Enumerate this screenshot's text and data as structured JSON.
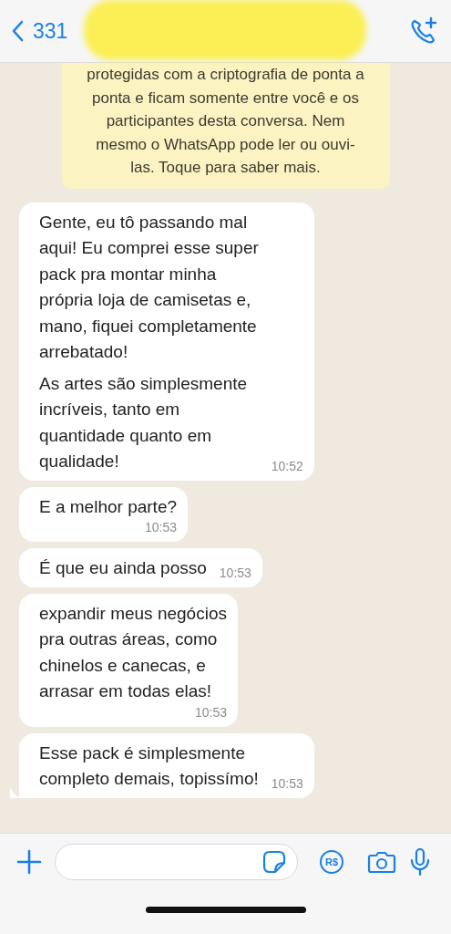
{
  "header": {
    "back_label": "331"
  },
  "encryption_notice": {
    "text": "protegidas com a criptografia de ponta a\nponta e ficam somente entre você e os\nparticipantes desta conversa. Nem\nmesmo o WhatsApp pode ler ou ouvi-\nlas. Toque para saber mais."
  },
  "messages": [
    {
      "kind": "inline",
      "paragraphs": [
        "Gente, eu tô passando mal\naqui! Eu comprei esse super\npack pra montar minha\nprópria loja de camisetas e,\nmano, fiquei completamente\narrebatado!",
        "As artes são simplesmente\nincríveis, tanto em\nquantidade quanto em\nqualidade!"
      ],
      "time": "10:52",
      "tail": false
    },
    {
      "kind": "stacked",
      "paragraphs": [
        "E a melhor parte?"
      ],
      "time": "10:53",
      "tail": false
    },
    {
      "kind": "inline",
      "paragraphs": [
        "É que eu ainda posso"
      ],
      "time": "10:53",
      "tail": false
    },
    {
      "kind": "stacked",
      "paragraphs": [
        "expandir meus negócios\npra outras áreas, como\nchinelos e canecas, e\narrasar em todas elas!"
      ],
      "time": "10:53",
      "tail": false
    },
    {
      "kind": "inline",
      "paragraphs": [
        "Esse pack é simplesmente\ncompleto demais, topissímo!"
      ],
      "time": "10:53",
      "tail": true
    }
  ],
  "composer": {
    "payment_label": "R$"
  }
}
